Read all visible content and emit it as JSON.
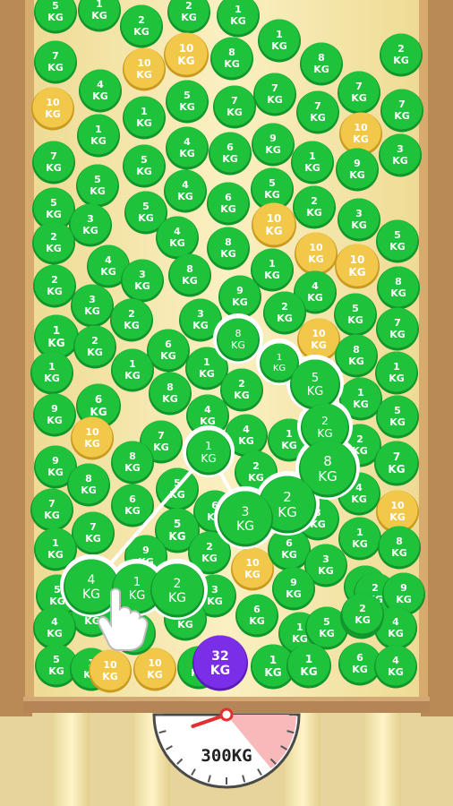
{
  "weight_unit": "KG",
  "scale": {
    "readout": "300KG",
    "fill_fraction": 0.3,
    "needle_color": "#e03030",
    "zone_color": "#f7b9b9"
  },
  "colors": {
    "ball_green": "#1ec23b",
    "ball_green_dark": "#12952c",
    "ball_gold": "#f2c84a",
    "ball_gold_dark": "#c99a1e",
    "ball_purple": "#7a2ee8",
    "chain_outline": "#ffffff",
    "wood": "#c89a62",
    "wood_dark": "#9c7240",
    "box_back": "#f4e4a4"
  },
  "balls": [
    {
      "w": 5,
      "c": "green"
    },
    {
      "w": 1,
      "c": "green"
    },
    {
      "w": 2,
      "c": "green"
    },
    {
      "w": 2,
      "c": "green"
    },
    {
      "w": 1,
      "c": "green"
    },
    {
      "w": 7,
      "c": "green"
    },
    {
      "w": 10,
      "c": "gold"
    },
    {
      "w": 8,
      "c": "green"
    },
    {
      "w": 1,
      "c": "green"
    },
    {
      "w": 8,
      "c": "green"
    },
    {
      "w": 2,
      "c": "green"
    },
    {
      "w": 10,
      "c": "gold"
    },
    {
      "w": 4,
      "c": "green"
    },
    {
      "w": 10,
      "c": "gold"
    },
    {
      "w": 1,
      "c": "green"
    },
    {
      "w": 5,
      "c": "green"
    },
    {
      "w": 7,
      "c": "green"
    },
    {
      "w": 7,
      "c": "green"
    },
    {
      "w": 7,
      "c": "green"
    },
    {
      "w": 7,
      "c": "green"
    },
    {
      "w": 10,
      "c": "gold"
    },
    {
      "w": 7,
      "c": "green"
    },
    {
      "w": 1,
      "c": "green"
    },
    {
      "w": 7,
      "c": "green"
    },
    {
      "w": 5,
      "c": "green"
    },
    {
      "w": 5,
      "c": "green"
    },
    {
      "w": 4,
      "c": "green"
    },
    {
      "w": 6,
      "c": "green"
    },
    {
      "w": 9,
      "c": "green"
    },
    {
      "w": 1,
      "c": "green"
    },
    {
      "w": 9,
      "c": "green"
    },
    {
      "w": 3,
      "c": "green"
    },
    {
      "w": 5,
      "c": "green"
    },
    {
      "w": 2,
      "c": "green"
    },
    {
      "w": 4,
      "c": "green"
    },
    {
      "w": 6,
      "c": "green"
    },
    {
      "w": 10,
      "c": "gold"
    },
    {
      "w": 5,
      "c": "green"
    },
    {
      "w": 3,
      "c": "green"
    },
    {
      "w": 5,
      "c": "green"
    },
    {
      "w": 2,
      "c": "green"
    },
    {
      "w": 8,
      "c": "green"
    },
    {
      "w": 4,
      "c": "green"
    },
    {
      "w": 10,
      "c": "gold"
    },
    {
      "w": 3,
      "c": "green"
    },
    {
      "w": 5,
      "c": "green"
    },
    {
      "w": 4,
      "c": "green"
    },
    {
      "w": 8,
      "c": "green"
    },
    {
      "w": 1,
      "c": "green"
    },
    {
      "w": 10,
      "c": "gold"
    },
    {
      "w": 3,
      "c": "green"
    },
    {
      "w": 2,
      "c": "green"
    },
    {
      "w": 4,
      "c": "green"
    },
    {
      "w": 8,
      "c": "green"
    },
    {
      "w": 3,
      "c": "green"
    },
    {
      "w": 9,
      "c": "green"
    },
    {
      "w": 2,
      "c": "green"
    },
    {
      "w": 2,
      "c": "green"
    },
    {
      "w": 3,
      "c": "green"
    },
    {
      "w": 5,
      "c": "green"
    },
    {
      "w": 1,
      "c": "green"
    },
    {
      "w": 2,
      "c": "green"
    },
    {
      "w": 6,
      "c": "green"
    },
    {
      "w": 10,
      "c": "gold"
    },
    {
      "w": 7,
      "c": "green"
    },
    {
      "w": 1,
      "c": "green"
    },
    {
      "w": 1,
      "c": "green"
    },
    {
      "w": 8,
      "c": "green"
    },
    {
      "w": 1,
      "c": "green"
    },
    {
      "w": 8,
      "c": "green"
    },
    {
      "w": 1,
      "c": "green"
    },
    {
      "w": 2,
      "c": "green"
    },
    {
      "w": 1,
      "c": "green"
    },
    {
      "w": 6,
      "c": "green"
    },
    {
      "w": 9,
      "c": "green"
    },
    {
      "w": 5,
      "c": "green"
    },
    {
      "w": 10,
      "c": "gold"
    },
    {
      "w": 7,
      "c": "green"
    },
    {
      "w": 4,
      "c": "green"
    },
    {
      "w": 4,
      "c": "green"
    },
    {
      "w": 1,
      "c": "green"
    },
    {
      "w": 9,
      "c": "green"
    },
    {
      "w": 8,
      "c": "green"
    },
    {
      "w": 2,
      "c": "green"
    },
    {
      "w": 7,
      "c": "green"
    },
    {
      "w": 2,
      "c": "green"
    },
    {
      "w": 8,
      "c": "green"
    },
    {
      "w": 7,
      "c": "green"
    },
    {
      "w": 6,
      "c": "green"
    },
    {
      "w": 5,
      "c": "green"
    },
    {
      "w": 6,
      "c": "green"
    },
    {
      "w": 3,
      "c": "green"
    },
    {
      "w": 4,
      "c": "green"
    },
    {
      "w": 10,
      "c": "gold"
    },
    {
      "w": 7,
      "c": "green"
    },
    {
      "w": 5,
      "c": "green"
    },
    {
      "w": 1,
      "c": "green"
    },
    {
      "w": 9,
      "c": "green"
    },
    {
      "w": 2,
      "c": "green"
    },
    {
      "w": 10,
      "c": "gold"
    },
    {
      "w": 6,
      "c": "green"
    },
    {
      "w": 3,
      "c": "green"
    },
    {
      "w": 1,
      "c": "green"
    },
    {
      "w": 8,
      "c": "green"
    },
    {
      "w": 2,
      "c": "green"
    },
    {
      "w": 5,
      "c": "green"
    },
    {
      "w": 3,
      "c": "green"
    },
    {
      "w": 9,
      "c": "green"
    },
    {
      "w": 2,
      "c": "green"
    },
    {
      "w": 9,
      "c": "green"
    },
    {
      "w": 1,
      "c": "green"
    },
    {
      "w": 9,
      "c": "green"
    },
    {
      "w": 6,
      "c": "green"
    },
    {
      "w": 1,
      "c": "green"
    },
    {
      "w": 5,
      "c": "green"
    },
    {
      "w": 4,
      "c": "green"
    },
    {
      "w": 4,
      "c": "green"
    },
    {
      "w": 5,
      "c": "green"
    },
    {
      "w": 1,
      "c": "green"
    },
    {
      "w": 10,
      "c": "gold"
    },
    {
      "w": 10,
      "c": "gold"
    },
    {
      "w": 8,
      "c": "green"
    },
    {
      "w": 1,
      "c": "green"
    },
    {
      "w": 1,
      "c": "green"
    },
    {
      "w": 32,
      "c": "purple"
    },
    {
      "w": 6,
      "c": "green"
    },
    {
      "w": 4,
      "c": "green"
    },
    {
      "w": 1,
      "c": "green"
    },
    {
      "w": 3,
      "c": "green"
    },
    {
      "w": 2,
      "c": "green"
    }
  ],
  "chain": [
    {
      "w": 8,
      "c": "green"
    },
    {
      "w": 1,
      "c": "green"
    },
    {
      "w": 5,
      "c": "green"
    },
    {
      "w": 2,
      "c": "green"
    },
    {
      "w": 8,
      "c": "green"
    },
    {
      "w": 2,
      "c": "green"
    },
    {
      "w": 3,
      "c": "green"
    },
    {
      "w": 1,
      "c": "green"
    },
    {
      "w": 4,
      "c": "green"
    },
    {
      "w": 1,
      "c": "green"
    },
    {
      "w": 2,
      "c": "green"
    }
  ]
}
